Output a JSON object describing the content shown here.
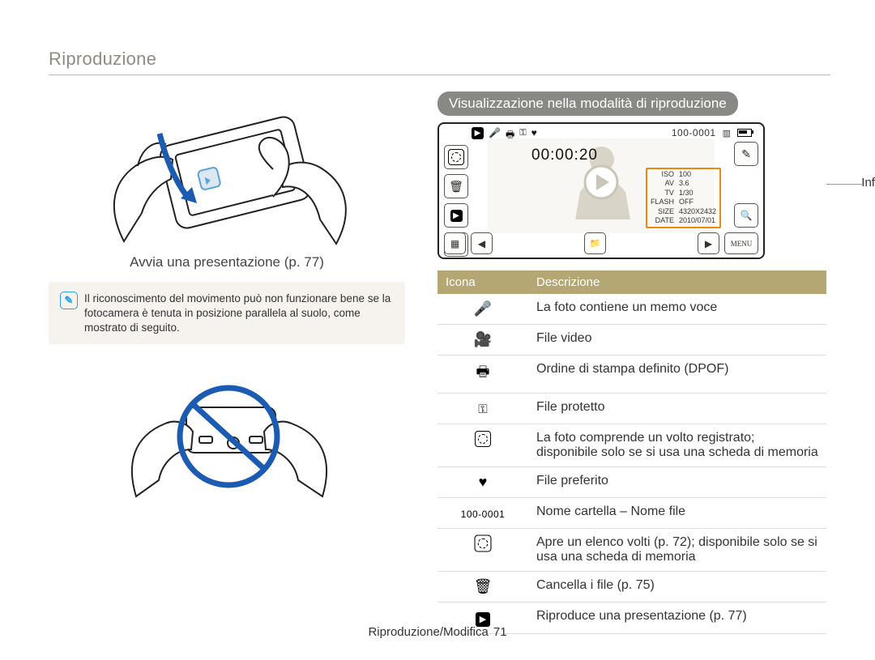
{
  "header": {
    "title": "Riproduzione"
  },
  "left": {
    "caption": "Avvia una presentazione (p. 77)",
    "note": "Il riconoscimento del movimento può non funzionare bene se la fotocamera è tenuta in posizione parallela al suolo, come mostrato di seguito."
  },
  "right": {
    "pill": "Visualizzazione nella modalità di riproduzione",
    "lcd": {
      "file_no": "100-0001",
      "timer": "00:00:20",
      "info_label": "Informazioni",
      "top_icons": [
        "mic",
        "video",
        "print",
        "key",
        "heart"
      ],
      "info": {
        "ISO": "100",
        "AV": "3.6",
        "TV": "1/30",
        "FLASH": "OFF",
        "SIZE": "4320X2432",
        "DATE": "2010/07/01"
      },
      "menu_label": "MENU"
    },
    "table": {
      "head": {
        "c1": "Icona",
        "c2": "Descrizione"
      },
      "rows": [
        {
          "icon": "mic",
          "desc": "La foto contiene un memo voce"
        },
        {
          "icon": "video",
          "desc": "File video"
        },
        {
          "icon": "print",
          "desc": "Ordine di stampa definito (DPOF)"
        },
        {
          "icon": "key",
          "desc": "File protetto"
        },
        {
          "icon": "face",
          "desc": "La foto comprende un volto registrato; disponibile solo se si usa una scheda di memoria"
        },
        {
          "icon": "heart",
          "desc": "File preferito"
        },
        {
          "icon": "fileno",
          "desc": "Nome cartella – Nome file"
        },
        {
          "icon": "facelist",
          "desc": "Apre un elenco volti (p. 72); disponibile solo se si usa una scheda di memoria"
        },
        {
          "icon": "trash",
          "desc": "Cancella i file (p. 75)"
        },
        {
          "icon": "playbox",
          "desc": "Riproduce una presentazione (p. 77)"
        }
      ]
    }
  },
  "footer": {
    "section": "Riproduzione/Modifica",
    "page": "71"
  }
}
